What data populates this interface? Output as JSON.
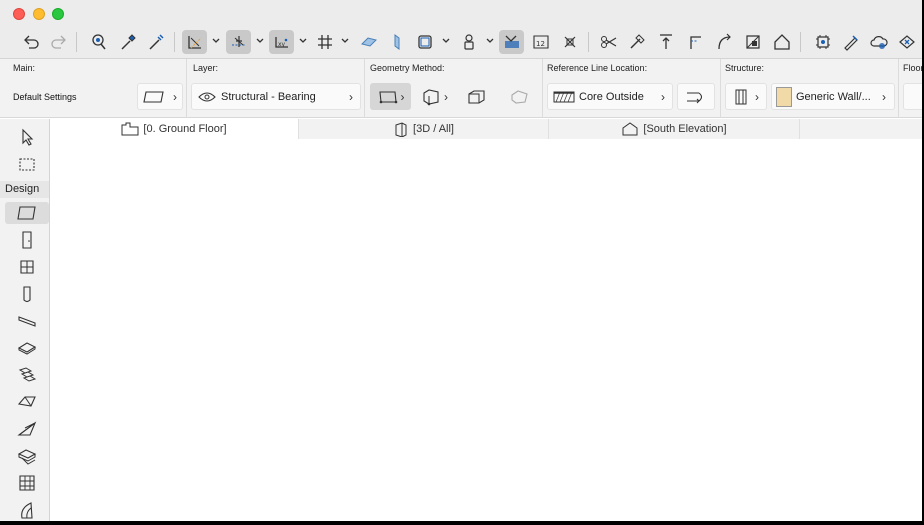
{
  "window": {
    "traffic_lights": [
      "close",
      "minimize",
      "zoom"
    ]
  },
  "toolbar": {
    "icons": [
      "undo-icon",
      "redo-icon",
      "pet-palette-icon",
      "eyedropper-icon",
      "syringe-icon",
      "guide-lines-icon",
      "snap-guides-icon",
      "snap-points-icon",
      "grid-snap-icon",
      "gravity-icon",
      "suspend-groups-icon",
      "layer-combo-icon",
      "renovation-icon",
      "trace-icon",
      "dimension-icon",
      "marquee-icon",
      "scissors-icon",
      "magic-wand-icon",
      "elevate-icon",
      "fillet-icon",
      "rotate-icon",
      "explode-icon",
      "home-icon",
      "bim-icon",
      "pen-icon",
      "cloud-icon",
      "sync-icon"
    ]
  },
  "infobox": {
    "main": {
      "label": "Main:",
      "value": "Default Settings"
    },
    "layer": {
      "label": "Layer:",
      "value": "Structural - Bearing"
    },
    "geometry": {
      "label": "Geometry Method:"
    },
    "reference": {
      "label": "Reference Line Location:",
      "value": "Core Outside"
    },
    "structure": {
      "label": "Structure:",
      "value": "Generic Wall/..."
    },
    "floor": {
      "label": "Floor"
    }
  },
  "tabs": [
    {
      "label": "[0. Ground Floor]"
    },
    {
      "label": "[3D / All]"
    },
    {
      "label": "[South Elevation]"
    }
  ],
  "toolbox": {
    "section_label": "Design",
    "tools": [
      "arrow-tool",
      "marquee-tool",
      "wall-tool",
      "door-tool",
      "window-tool",
      "column-tool",
      "beam-tool",
      "slab-tool",
      "stair-tool",
      "roof-tool",
      "shell-tool",
      "morph-tool",
      "curtain-wall-tool",
      "zone-tool"
    ]
  }
}
